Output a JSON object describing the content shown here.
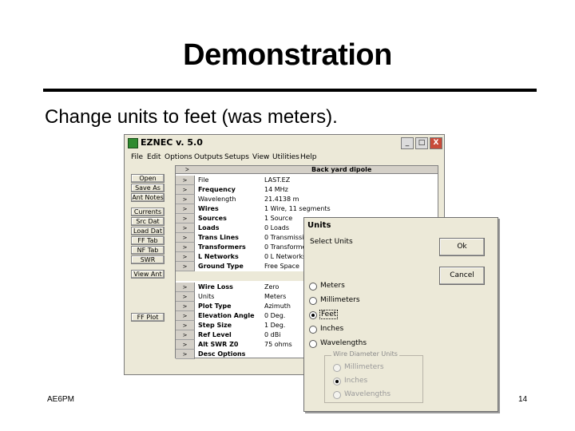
{
  "slide": {
    "title": "Demonstration",
    "subtitle": "Change units to feet (was meters).",
    "footer_left": "AE6PM",
    "page_number": "14"
  },
  "window": {
    "title": "EZNEC v. 5.0",
    "minimize": "_",
    "maximize": "□",
    "close": "X",
    "menu": [
      "File",
      "Edit",
      "Options",
      "Outputs",
      "Setups",
      "View",
      "Utilities",
      "Help"
    ]
  },
  "left_buttons": [
    "Open",
    "Save As",
    "Ant Notes",
    "Currents",
    "Src Dat",
    "Load Dat",
    "FF Tab",
    "NF Tab",
    "SWR",
    "View Ant",
    "FF Plot"
  ],
  "grid": {
    "header_arrow": ">",
    "header_title": "Back yard dipole",
    "arrow": ">",
    "rows_top": [
      {
        "name": "File",
        "value": "LAST.EZ"
      },
      {
        "name": "Frequency",
        "value": "14 MHz"
      },
      {
        "name": "Wavelength",
        "value": "21.4138 m"
      },
      {
        "name": "Wires",
        "value": "1 Wire, 11 segments"
      },
      {
        "name": "Sources",
        "value": "1 Source"
      },
      {
        "name": "Loads",
        "value": "0 Loads"
      },
      {
        "name": "Trans Lines",
        "value": "0 Transmissio"
      },
      {
        "name": "Transformers",
        "value": "0 Transforme"
      },
      {
        "name": "L Networks",
        "value": "0 L Networks"
      },
      {
        "name": "Ground Type",
        "value": "Free Space"
      }
    ],
    "rows_bottom": [
      {
        "name": "Wire Loss",
        "value": "Zero"
      },
      {
        "name": "Units",
        "value": "Meters"
      },
      {
        "name": "Plot Type",
        "value": "Azimuth"
      },
      {
        "name": "Elevation Angle",
        "value": "0 Deg."
      },
      {
        "name": "Step Size",
        "value": "1 Deg."
      },
      {
        "name": "Ref Level",
        "value": "0 dBi"
      },
      {
        "name": "Alt SWR Z0",
        "value": "75 ohms"
      },
      {
        "name": "Desc Options",
        "value": ""
      }
    ]
  },
  "dialog": {
    "title": "Units",
    "label": "Select Units",
    "ok": "Ok",
    "cancel": "Cancel",
    "options": [
      "Meters",
      "Millimeters",
      "Feet",
      "Inches",
      "Wavelengths"
    ],
    "selected": "Feet",
    "group_title": "Wire Diameter Units",
    "group_options": [
      "Millimeters",
      "Inches",
      "Wavelengths"
    ],
    "group_selected": "Inches"
  }
}
